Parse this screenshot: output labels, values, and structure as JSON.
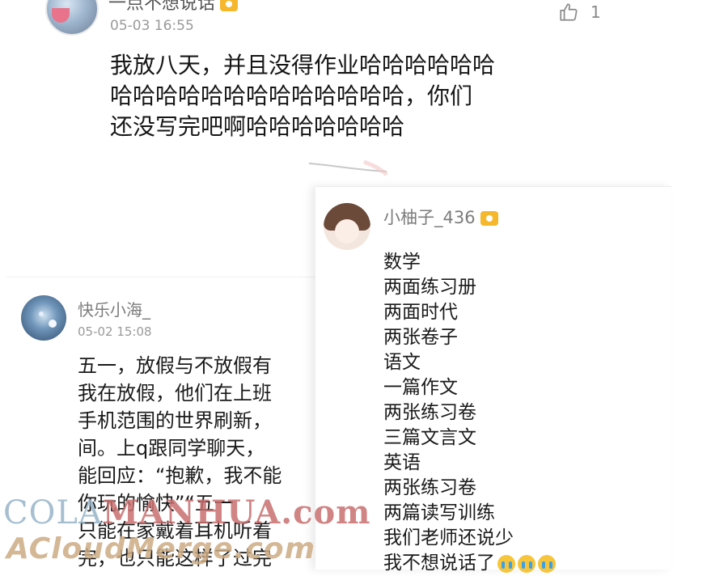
{
  "top_comment": {
    "username": "一点不想说话",
    "time": "05-03 16:55",
    "like_count": "1",
    "icons": {
      "like": "thumbs-up-icon",
      "badge": "vip-badge-icon"
    },
    "text_lines": [
      "我放八天，并且没得作业哈哈哈哈哈哈",
      "哈哈哈哈哈哈哈哈哈哈哈哈哈，你们",
      "还没写完吧啊哈哈哈哈哈哈哈"
    ]
  },
  "left_comment": {
    "username": "快乐小海_",
    "time": "05-02 15:08",
    "text_lines": [
      "五一，放假与不放假有",
      "我在放假，他们在上班",
      "手机范围的世界刷新，",
      "间。上q跟同学聊天，",
      "能回应：“抱歉，我不能",
      "你玩的愉快”“五一",
      "只能在家戴着耳机听着",
      "完，也只能这样了过完"
    ]
  },
  "right_comment": {
    "username": "小柚子_436",
    "items": [
      "数学",
      "两面练习册",
      "两面时代",
      "两张卷子",
      "语文",
      "一篇作文",
      "两张练习卷",
      "三篇文言文",
      "英语",
      "两张练习卷",
      "两篇读写训练",
      "我们老师还说少",
      "我不想说话了"
    ],
    "trailing_emoji_count": 3,
    "icons": {
      "badge": "vip-badge-icon",
      "emoji": "crying-face-icon"
    }
  },
  "watermark": {
    "line1_a": "COLA",
    "line1_b": "MANHUA.com",
    "line2": "ACloudMerge.com"
  }
}
